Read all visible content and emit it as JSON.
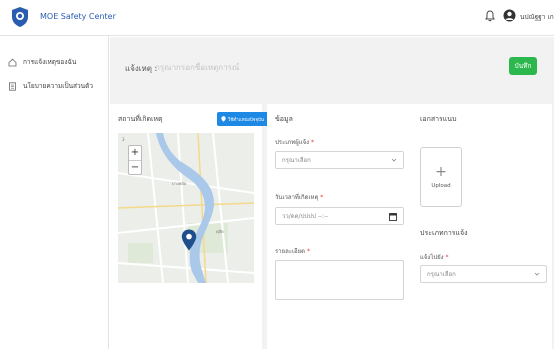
{
  "header": {
    "app_title": "MOE Safety Center",
    "username": "นปณัฐฐา เกลือเติมพันธ์"
  },
  "sidebar": {
    "items": [
      {
        "label": "การแจ้งเหตุของฉัน",
        "icon": "home-icon"
      },
      {
        "label": "นโยบายความเป็นส่วนตัว",
        "icon": "document-icon"
      }
    ]
  },
  "subject": {
    "label": "แจ้งเหตุ :",
    "placeholder": "กรุณากรอกชื่อเหตุการณ์",
    "save_label": "บันทึก"
  },
  "location_panel": {
    "title": "สถานที่เกิดเหตุ",
    "locate_label": "ใช้ตำแหน่งปัจจุบัน",
    "zoom_in": "+",
    "zoom_out": "−"
  },
  "info_panel": {
    "title": "ข้อมูล",
    "reporter_type_label": "ประเภทผู้แจ้ง",
    "reporter_type_value": "กรุณาเลือก",
    "datetime_label": "วันเวลาที่เกิดเหตุ",
    "datetime_placeholder": "วว/ดด/ปปปป --:--",
    "details_label": "รายละเอียด",
    "required_mark": "*"
  },
  "documents_panel": {
    "title": "เอกสารแนบ",
    "upload_plus": "+",
    "upload_label": "Upload",
    "report_section_title": "ประเภทการแจ้ง",
    "report_to_label": "แจ้งไปยัง",
    "report_to_value": "กรุณาเลือก"
  },
  "colors": {
    "primary_blue": "#1e88e5",
    "save_green": "#2db84d",
    "title_blue": "#2a5db0",
    "required_red": "#e53935"
  }
}
